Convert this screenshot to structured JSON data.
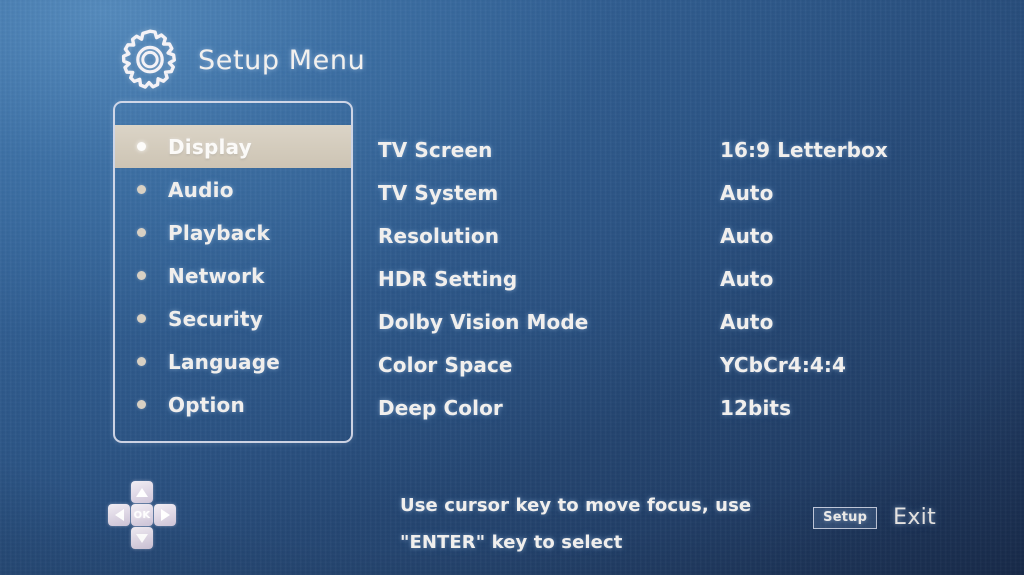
{
  "header": {
    "icon": "gear-icon",
    "title": "Setup Menu"
  },
  "colors": {
    "background_top_left": "#3b72ab",
    "background_bottom_right": "#1b3054",
    "panel_border": "#e2e4f0",
    "highlight_band": "#d4ccbd",
    "text": "#f1efed",
    "bullet": "#d8d0c3"
  },
  "sidebar": {
    "selected_index": 0,
    "items": [
      {
        "label": "Display",
        "selected": true
      },
      {
        "label": "Audio",
        "selected": false
      },
      {
        "label": "Playback",
        "selected": false
      },
      {
        "label": "Network",
        "selected": false
      },
      {
        "label": "Security",
        "selected": false
      },
      {
        "label": "Language",
        "selected": false
      },
      {
        "label": "Option",
        "selected": false
      }
    ]
  },
  "settings": {
    "rows": [
      {
        "label": "TV Screen",
        "value": "16:9 Letterbox"
      },
      {
        "label": "TV System",
        "value": "Auto"
      },
      {
        "label": "Resolution",
        "value": "Auto"
      },
      {
        "label": "HDR Setting",
        "value": "Auto"
      },
      {
        "label": "Dolby Vision Mode",
        "value": "Auto"
      },
      {
        "label": "Color Space",
        "value": "YCbCr4:4:4"
      },
      {
        "label": "Deep Color",
        "value": "12bits"
      }
    ]
  },
  "dpad": {
    "up": "up-arrow-icon",
    "down": "down-arrow-icon",
    "left": "left-arrow-icon",
    "right": "right-arrow-icon",
    "ok_label": "OK"
  },
  "hint": {
    "line1": "Use cursor key to move focus, use",
    "line2": "\"ENTER\" key to select"
  },
  "footer": {
    "setup_label": "Setup",
    "exit_label": "Exit"
  }
}
